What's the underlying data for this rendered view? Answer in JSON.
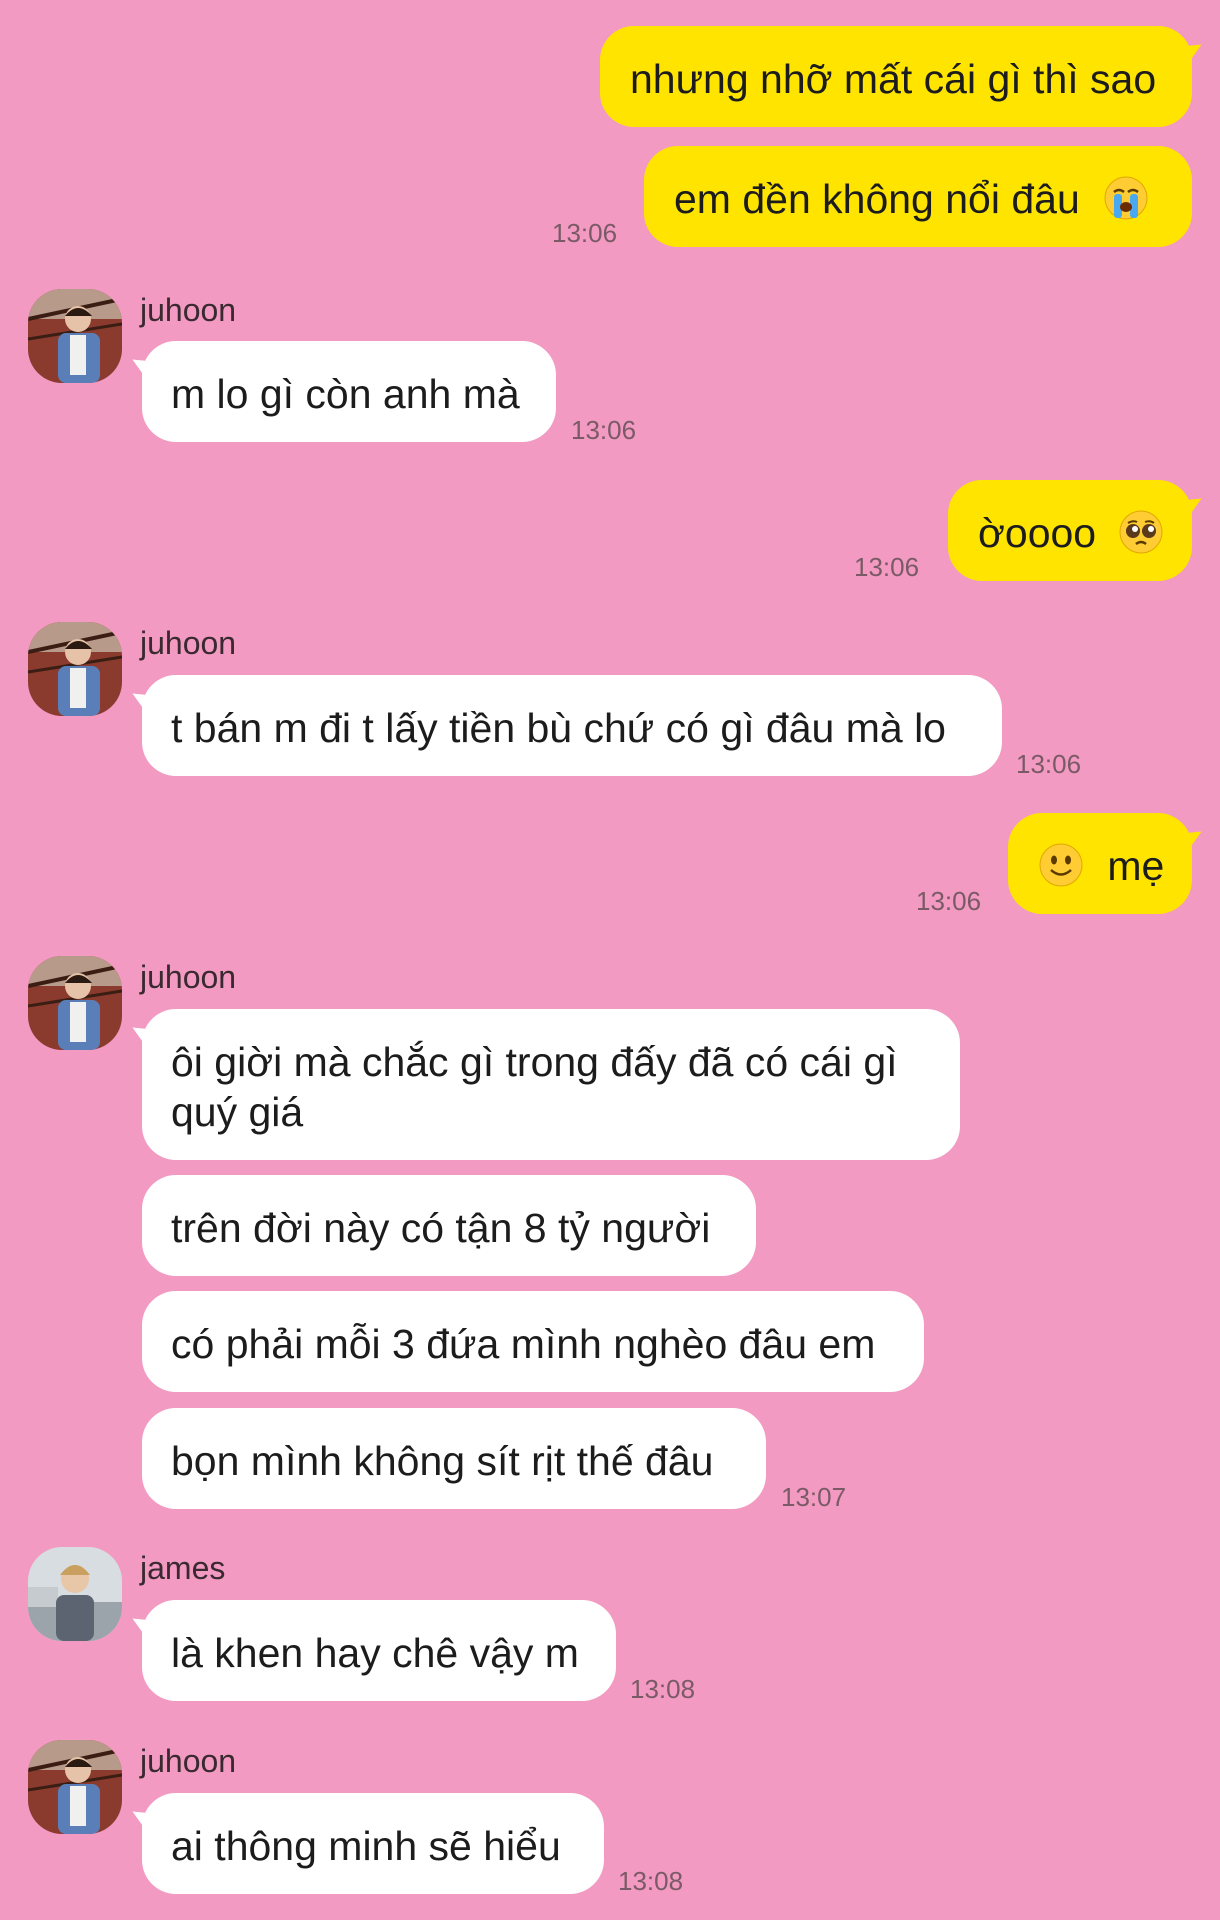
{
  "colors": {
    "background": "#f29ac2",
    "outgoing_bubble": "#ffe400",
    "incoming_bubble": "#ffffff"
  },
  "messages": {
    "m1": {
      "text": "nhưng nhỡ mất cái gì thì sao"
    },
    "m2": {
      "text": "em đền không nổi đâu",
      "emoji": "loudly-crying-face",
      "time": "13:06"
    },
    "m3": {
      "sender": "juhoon",
      "text": "m lo gì còn anh mà",
      "time": "13:06"
    },
    "m4": {
      "text": "ờoooo",
      "emoji": "pleading-face",
      "time": "13:06"
    },
    "m5": {
      "sender": "juhoon",
      "text": "t bán m đi t lấy tiền bù chứ có gì đâu mà lo",
      "time": "13:06"
    },
    "m6": {
      "text": "mẹ",
      "emoji": "slightly-smiling-face",
      "time": "13:06"
    },
    "m7": {
      "sender": "juhoon",
      "text": "ôi giời mà chắc gì trong đấy đã có cái gì quý giá"
    },
    "m8": {
      "text": "trên đời này có tận 8 tỷ người"
    },
    "m9": {
      "text": "có phải mỗi 3 đứa mình nghèo đâu em"
    },
    "m10": {
      "text": "bọn mình không sít rịt thế đâu",
      "time": "13:07"
    },
    "m11": {
      "sender": "james",
      "text": "là khen hay chê vậy m",
      "time": "13:08"
    },
    "m12": {
      "sender": "juhoon",
      "text": "ai thông minh sẽ hiểu",
      "time": "13:08"
    }
  }
}
